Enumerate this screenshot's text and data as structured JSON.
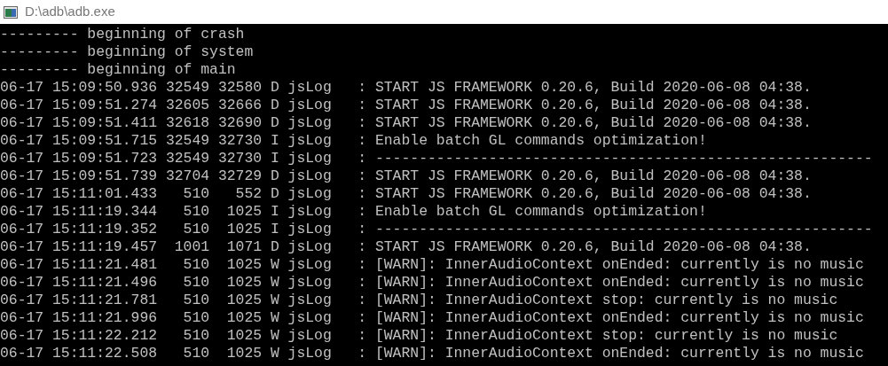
{
  "window": {
    "title": "D:\\adb\\adb.exe"
  },
  "console": {
    "lines": [
      "--------- beginning of crash",
      "--------- beginning of system",
      "--------- beginning of main",
      "06-17 15:09:50.936 32549 32580 D jsLog   : START JS FRAMEWORK 0.20.6, Build 2020-06-08 04:38.",
      "06-17 15:09:51.274 32605 32666 D jsLog   : START JS FRAMEWORK 0.20.6, Build 2020-06-08 04:38.",
      "06-17 15:09:51.411 32618 32690 D jsLog   : START JS FRAMEWORK 0.20.6, Build 2020-06-08 04:38.",
      "06-17 15:09:51.715 32549 32730 I jsLog   : Enable batch GL commands optimization!",
      "06-17 15:09:51.723 32549 32730 I jsLog   : ---------------------------------------------------------",
      "06-17 15:09:51.739 32704 32729 D jsLog   : START JS FRAMEWORK 0.20.6, Build 2020-06-08 04:38.",
      "06-17 15:11:01.433   510   552 D jsLog   : START JS FRAMEWORK 0.20.6, Build 2020-06-08 04:38.",
      "06-17 15:11:19.344   510  1025 I jsLog   : Enable batch GL commands optimization!",
      "06-17 15:11:19.352   510  1025 I jsLog   : ---------------------------------------------------------",
      "06-17 15:11:19.457  1001  1071 D jsLog   : START JS FRAMEWORK 0.20.6, Build 2020-06-08 04:38.",
      "06-17 15:11:21.481   510  1025 W jsLog   : [WARN]: InnerAudioContext onEnded: currently is no music",
      "06-17 15:11:21.496   510  1025 W jsLog   : [WARN]: InnerAudioContext onEnded: currently is no music",
      "06-17 15:11:21.781   510  1025 W jsLog   : [WARN]: InnerAudioContext stop: currently is no music",
      "06-17 15:11:21.996   510  1025 W jsLog   : [WARN]: InnerAudioContext onEnded: currently is no music",
      "06-17 15:11:22.212   510  1025 W jsLog   : [WARN]: InnerAudioContext stop: currently is no music",
      "06-17 15:11:22.508   510  1025 W jsLog   : [WARN]: InnerAudioContext onEnded: currently is no music"
    ]
  }
}
